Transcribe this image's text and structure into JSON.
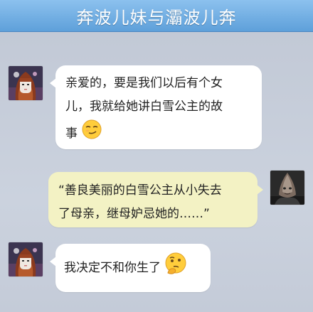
{
  "header": {
    "title": "奔波儿妹与灞波儿奔"
  },
  "messages": [
    {
      "sender": "girl",
      "side": "left",
      "text_line1": "亲爱的，要是我们以后有个女",
      "text_line2": "儿，我就给她讲白雪公主的故",
      "text_line3": "事",
      "emoji": "smug-emoji"
    },
    {
      "sender": "boy",
      "side": "right",
      "text_line1": "“善良美丽的白雪公主从小失去",
      "text_line2": "了母亲，继母妒忌她的……”"
    },
    {
      "sender": "girl",
      "side": "left",
      "text_line1": "我决定不和你生了",
      "emoji": "thinking-emoji"
    }
  ],
  "colors": {
    "header": "#6aa9e0",
    "background": "#c6cdd9",
    "incoming_bubble": "#ffffff",
    "outgoing_bubble": "#f3f2c4"
  }
}
